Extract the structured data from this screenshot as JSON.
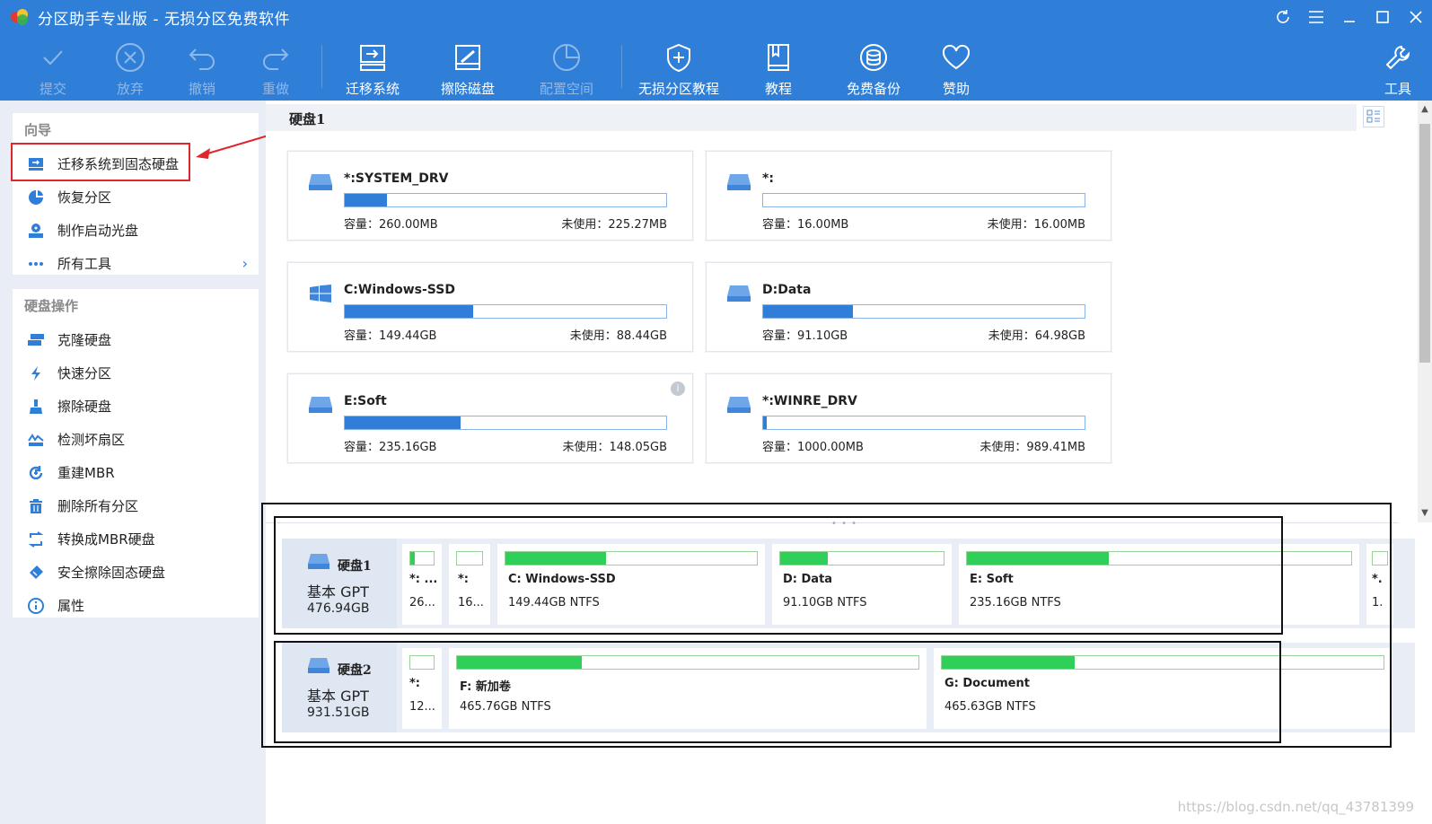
{
  "window": {
    "title": "分区助手专业版 - 无损分区免费软件",
    "controls": [
      "refresh-icon",
      "menu-icon",
      "minimize-icon",
      "maximize-icon",
      "close-icon"
    ]
  },
  "toolbar": {
    "commit": "提交",
    "discard": "放弃",
    "undo": "撤销",
    "redo": "重做",
    "migrate": "迁移系统",
    "wipe_disk": "擦除磁盘",
    "allocate": "配置空间",
    "tutorial_lossless": "无损分区教程",
    "tutorial": "教程",
    "backup": "免费备份",
    "donate": "赞助",
    "tools": "工具"
  },
  "sidebar": {
    "wizard_title": "向导",
    "wizard_items": [
      {
        "label": "迁移系统到固态硬盘",
        "icon": "migrate-ssd-icon"
      },
      {
        "label": "恢复分区",
        "icon": "recover-partition-icon"
      },
      {
        "label": "制作启动光盘",
        "icon": "bootable-disc-icon"
      },
      {
        "label": "所有工具",
        "icon": "more-icon"
      }
    ],
    "disk_ops_title": "硬盘操作",
    "disk_ops_items": [
      {
        "label": "克隆硬盘",
        "icon": "clone-disk-icon"
      },
      {
        "label": "快速分区",
        "icon": "quick-partition-icon"
      },
      {
        "label": "擦除硬盘",
        "icon": "wipe-disk-icon"
      },
      {
        "label": "检测坏扇区",
        "icon": "bad-sector-icon"
      },
      {
        "label": "重建MBR",
        "icon": "rebuild-mbr-icon"
      },
      {
        "label": "删除所有分区",
        "icon": "delete-all-icon"
      },
      {
        "label": "转换成MBR硬盘",
        "icon": "convert-mbr-icon"
      },
      {
        "label": "安全擦除固态硬盘",
        "icon": "secure-erase-icon"
      },
      {
        "label": "属性",
        "icon": "properties-icon"
      }
    ]
  },
  "main": {
    "disk_title": "硬盘1",
    "partitions": [
      {
        "name": "*:SYSTEM_DRV",
        "cap_label": "容量：260.00MB",
        "free_label": "未使用：225.27MB",
        "used_fraction": 0.13,
        "icon": "drive-icon"
      },
      {
        "name": "*:",
        "cap_label": "容量：16.00MB",
        "free_label": "未使用：16.00MB",
        "used_fraction": 0.0,
        "icon": "drive-icon"
      },
      {
        "name": "C:Windows-SSD",
        "cap_label": "容量：149.44GB",
        "free_label": "未使用：88.44GB",
        "used_fraction": 0.4,
        "icon": "windows-icon"
      },
      {
        "name": "D:Data",
        "cap_label": "容量：91.10GB",
        "free_label": "未使用：64.98GB",
        "used_fraction": 0.28,
        "icon": "drive-icon"
      },
      {
        "name": "E:Soft",
        "cap_label": "容量：235.16GB",
        "free_label": "未使用：148.05GB",
        "used_fraction": 0.36,
        "icon": "drive-icon"
      },
      {
        "name": "*:WINRE_DRV",
        "cap_label": "容量：1000.00MB",
        "free_label": "未使用：989.41MB",
        "used_fraction": 0.01,
        "icon": "drive-icon"
      }
    ]
  },
  "disks": [
    {
      "name": "硬盘1",
      "type": "基本 GPT",
      "size": "476.94GB",
      "segments": [
        {
          "name": "*: ...",
          "info": "26...",
          "used_fraction": 0.2
        },
        {
          "name": "*:",
          "info": "16...",
          "used_fraction": 0.0
        },
        {
          "name": "C: Windows-SSD",
          "info": "149.44GB NTFS",
          "used_fraction": 0.4
        },
        {
          "name": "D: Data",
          "info": "91.10GB NTFS",
          "used_fraction": 0.29
        },
        {
          "name": "E: Soft",
          "info": "235.16GB NTFS",
          "used_fraction": 0.37
        },
        {
          "name": "*.",
          "info": "1.",
          "used_fraction": 0.0
        }
      ]
    },
    {
      "name": "硬盘2",
      "type": "基本 GPT",
      "size": "931.51GB",
      "segments": [
        {
          "name": "*:",
          "info": "12...",
          "used_fraction": 0.0
        },
        {
          "name": "F: 新加卷",
          "info": "465.76GB NTFS",
          "used_fraction": 0.27
        },
        {
          "name": "G: Document",
          "info": "465.63GB NTFS",
          "used_fraction": 0.3
        }
      ]
    }
  ],
  "watermark": "https://blog.csdn.net/qq_43781399",
  "colors": {
    "accent": "#2f7fd8",
    "used_bar_green": "#2fcf5a",
    "highlight_red": "#e0262a"
  }
}
